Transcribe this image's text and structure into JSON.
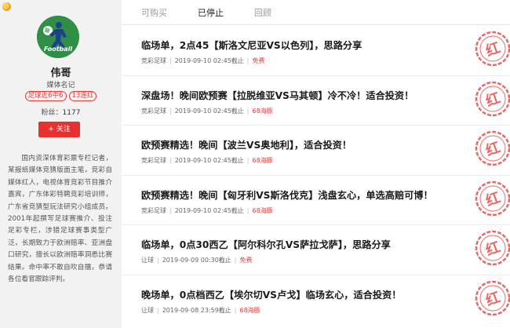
{
  "profile": {
    "avatar_text": "Football",
    "name": "伟哥",
    "role": "媒体名记",
    "tags": [
      "足球近6中6",
      "13连红"
    ],
    "fans_label": "粉丝：",
    "fans_count": "1177",
    "follow_label": "+ 关注",
    "bio": "国内资深体育彩票专栏记者，某报纸媒体竞猜版面主笔，竞彩自媒体红人，电视体育竞彩节目推介嘉宾，广东体彩特聘竞彩培训师，广东省竞猜型玩法研究小组成员。2001年起撰写足球赛推介、投注足彩专栏，涉猎足球赛事类型广泛，长期致力于欧洲赔率、亚洲盘口研究，擅长以欧洲赔率洞悉比赛结果。命中率不敢自吹自擂，恭请各位看官跟踪评判。"
  },
  "tabs": [
    {
      "label": "可购买",
      "active": false
    },
    {
      "label": "已停止",
      "active": true
    },
    {
      "label": "回顾",
      "active": false
    }
  ],
  "stamp_text": "红",
  "colors": {
    "accent": "#e8302e",
    "stamp": "#e56a66"
  },
  "items": [
    {
      "title": "临场单，2点45【斯洛文尼亚VS以色列】，思路分享",
      "category": "竞彩足球",
      "time": "2019-09-10 02:45截止",
      "price": "免费"
    },
    {
      "title": "深盘场！晚间欧预赛【拉脱维亚VS马其顿】冷不冷！适合投资！",
      "category": "竞彩足球",
      "time": "2019-09-10 02:45截止",
      "price": "68海豚"
    },
    {
      "title": "欧预赛精选！晚间【波兰VS奥地利】，适合投资！",
      "category": "竞彩足球",
      "time": "2019-09-10 02:45截止",
      "price": "68海豚"
    },
    {
      "title": "欧预赛精选！晚间【匈牙利VS斯洛伐克】浅盘玄心，单选高赔可博！",
      "category": "竞彩足球",
      "time": "2019-09-10 02:45截止",
      "price": "68海豚"
    },
    {
      "title": "临场单，0点30西乙【阿尔科尔孔VS萨拉戈萨】，思路分享",
      "category": "让球",
      "time": "2019-09-09 00:30截止",
      "price": "免费"
    },
    {
      "title": "晚场单，0点档西乙【埃尔切VS卢戈】临场玄心，适合投资！",
      "category": "让球",
      "time": "2019-09-08 23:59截止",
      "price": "68海豚"
    }
  ]
}
